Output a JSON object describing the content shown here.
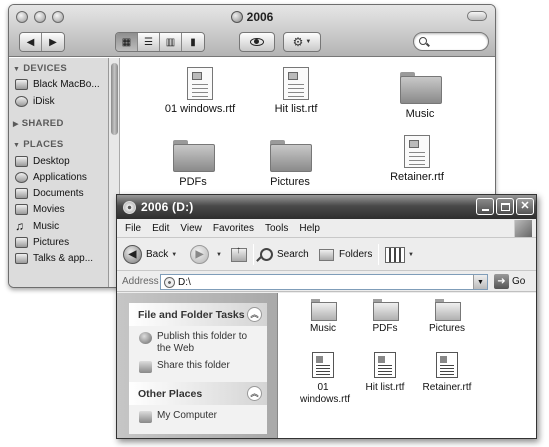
{
  "mac_window": {
    "title": "2006",
    "sidebar": {
      "sections": [
        {
          "label": "DEVICES",
          "items": [
            {
              "label": "Black MacBo..."
            },
            {
              "label": "iDisk"
            }
          ]
        },
        {
          "label": "SHARED",
          "items": []
        },
        {
          "label": "PLACES",
          "items": [
            {
              "label": "Desktop"
            },
            {
              "label": "Applications"
            },
            {
              "label": "Documents"
            },
            {
              "label": "Movies"
            },
            {
              "label": "Music"
            },
            {
              "label": "Pictures"
            },
            {
              "label": "Talks & app..."
            }
          ]
        }
      ]
    },
    "files": [
      {
        "name": "01 windows.rtf",
        "kind": "document"
      },
      {
        "name": "Hit list.rtf",
        "kind": "document"
      },
      {
        "name": "Music",
        "kind": "folder"
      },
      {
        "name": "PDFs",
        "kind": "folder"
      },
      {
        "name": "Pictures",
        "kind": "folder"
      },
      {
        "name": "Retainer.rtf",
        "kind": "document"
      }
    ],
    "view_buttons": [
      "icon-view",
      "list-view",
      "column-view",
      "coverflow-view"
    ],
    "icons": {
      "back": "◀",
      "forward": "▶",
      "quicklook": "eye-icon",
      "action": "gear-icon"
    }
  },
  "xp_window": {
    "title": "2006 (D:)",
    "menu": [
      "File",
      "Edit",
      "View",
      "Favorites",
      "Tools",
      "Help"
    ],
    "toolbar": {
      "back": "Back",
      "search": "Search",
      "folders": "Folders"
    },
    "address": {
      "label": "Address",
      "value": "D:\\",
      "go": "Go"
    },
    "tasks": [
      {
        "title": "File and Folder Tasks",
        "links": [
          "Publish this folder to the Web",
          "Share this folder"
        ]
      },
      {
        "title": "Other Places",
        "links": [
          "My Computer"
        ]
      }
    ],
    "files": [
      {
        "name": "Music",
        "kind": "folder"
      },
      {
        "name": "PDFs",
        "kind": "folder"
      },
      {
        "name": "Pictures",
        "kind": "folder"
      },
      {
        "name": "01 windows.rtf",
        "kind": "document"
      },
      {
        "name": "Hit list.rtf",
        "kind": "document"
      },
      {
        "name": "Retainer.rtf",
        "kind": "document"
      }
    ]
  }
}
